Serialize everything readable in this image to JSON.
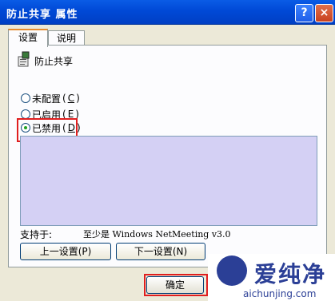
{
  "window": {
    "title": "防止共享 属性",
    "help_glyph": "?",
    "close_glyph": "×"
  },
  "tabs": [
    {
      "label": "设置",
      "active": true
    },
    {
      "label": "说明",
      "active": false
    }
  ],
  "policy": {
    "title": "防止共享",
    "icon": "group-policy-icon"
  },
  "radios": [
    {
      "label": "未配置",
      "key": "C",
      "checked": false
    },
    {
      "label": "已启用",
      "key": "E",
      "checked": false
    },
    {
      "label": "已禁用",
      "key": "D",
      "checked": true
    }
  ],
  "support": {
    "label": "支持于:",
    "value": "至少是 Windows NetMeeting v3.0"
  },
  "buttons": {
    "prev": "上一设置(P)",
    "next": "下一设置(N)",
    "ok": "确定"
  },
  "watermark": {
    "main": "爱纯净",
    "sub": "aichunjing.com"
  },
  "colors": {
    "title_bar": "#0049d6",
    "highlight": "#e01e1e",
    "desc_bg": "#d4d0f4"
  }
}
